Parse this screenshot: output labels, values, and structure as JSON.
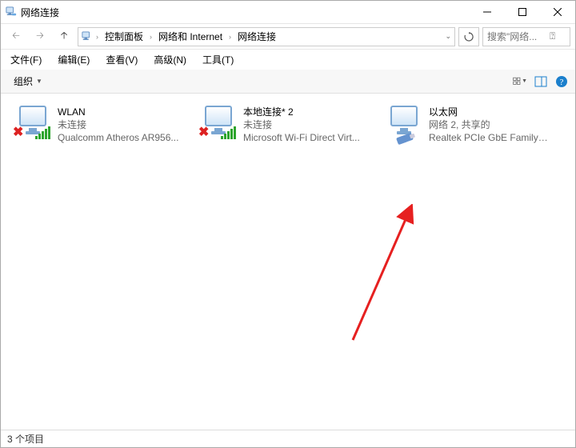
{
  "window": {
    "title": "网络连接"
  },
  "breadcrumb": {
    "items": [
      "控制面板",
      "网络和 Internet",
      "网络连接"
    ]
  },
  "search": {
    "placeholder": "搜索\"网络..."
  },
  "menu": {
    "file": "文件(F)",
    "edit": "编辑(E)",
    "view": "查看(V)",
    "advanced": "高级(N)",
    "tools": "工具(T)"
  },
  "toolbar": {
    "organize": "组织"
  },
  "items": [
    {
      "name": "WLAN",
      "status": "未连接",
      "desc": "Qualcomm Atheros AR956..."
    },
    {
      "name": "本地连接* 2",
      "status": "未连接",
      "desc": "Microsoft Wi-Fi Direct Virt..."
    },
    {
      "name": "以太网",
      "status": "网络 2, 共享的",
      "desc": "Realtek PCIe GbE Family C..."
    }
  ],
  "status": {
    "text": "3 个项目"
  }
}
